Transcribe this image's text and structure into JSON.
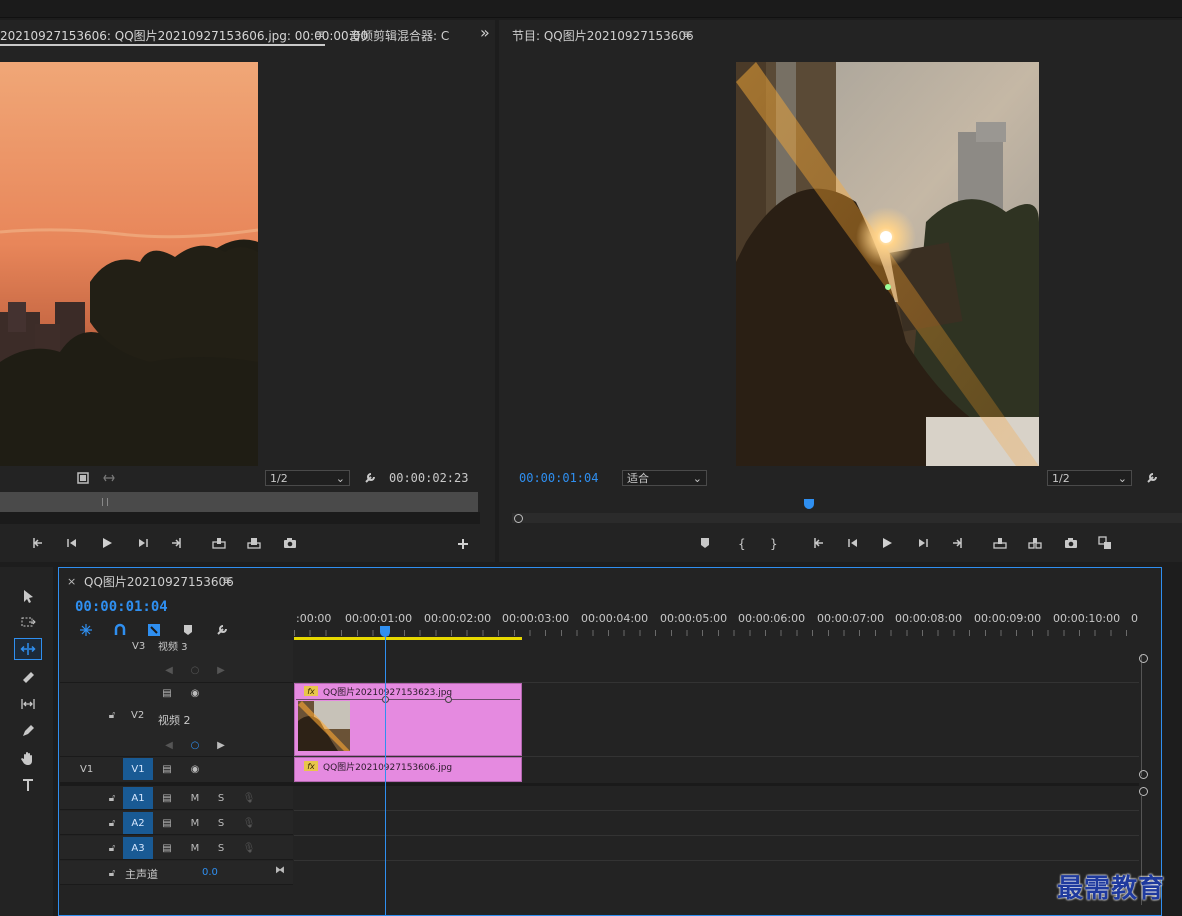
{
  "source_monitor": {
    "tab_label": "20210927153606: QQ图片20210927153606.jpg: 00:00:00:00",
    "tab2_label": "音频剪辑混合器: C",
    "overflow": "»",
    "resolution": "1/2",
    "duration": "00:00:02:23"
  },
  "program_monitor": {
    "tab_label": "节目: QQ图片20210927153606",
    "timecode": "00:00:01:04",
    "zoom": "适合",
    "resolution": "1/2"
  },
  "timeline": {
    "tab_label": "QQ图片20210927153606",
    "close": "×",
    "timecode": "00:00:01:04",
    "ruler": [
      ":00:00",
      "00:00:01:00",
      "00:00:02:00",
      "00:00:03:00",
      "00:00:04:00",
      "00:00:05:00",
      "00:00:06:00",
      "00:00:07:00",
      "00:00:08:00",
      "00:00:09:00",
      "00:00:10:00",
      "0"
    ],
    "tracks": {
      "v3": {
        "id": "V3",
        "name": "视频 3"
      },
      "v2": {
        "id": "V2",
        "name": "视频 2"
      },
      "v1": {
        "src": "V1",
        "id": "V1"
      },
      "a1": {
        "id": "A1",
        "m": "M",
        "s": "S"
      },
      "a2": {
        "id": "A2",
        "m": "M",
        "s": "S"
      },
      "a3": {
        "id": "A3",
        "m": "M",
        "s": "S"
      },
      "master": {
        "name": "主声道",
        "value": "0.0"
      }
    },
    "clips": {
      "v2_clip": "QQ图片20210927153623.jpg",
      "v1_clip": "QQ图片20210927153606.jpg",
      "fx": "fx"
    }
  },
  "watermark": "最需教育",
  "colors": {
    "accent": "#2f8ff0",
    "clip": "#e58ae0",
    "track_target": "#195a94",
    "work_area": "#e6d800"
  }
}
